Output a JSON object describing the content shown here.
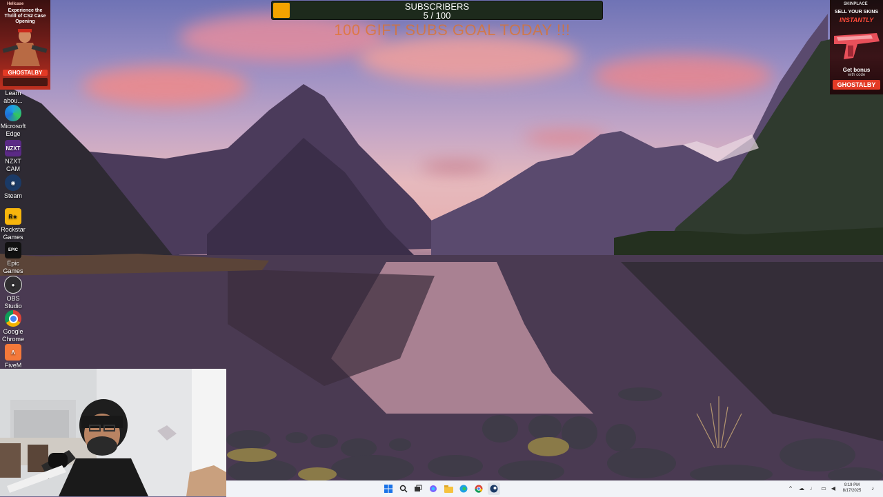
{
  "overlay": {
    "sub_title": "SUBSCRIBERS",
    "sub_count": "5 / 100",
    "sub_progress": 0.05,
    "goal_text": "100 GIFT SUBS GOAL TODAY !!!"
  },
  "ad_left": {
    "brand": "Hellcase",
    "headline": "Experience the Thrill of CS2 Case Opening",
    "code": "GHOSTALBY"
  },
  "ad_right": {
    "brand": "SKINPLACE",
    "headline1": "SELL YOUR SKINS",
    "headline2": "INSTANTLY",
    "bonus": "Get bonus",
    "bonus_sub": "with code",
    "code": "GHOSTALBY"
  },
  "desktop_icons": [
    {
      "label": "Learn abou...",
      "icon": "learn-icon"
    },
    {
      "label": "Microsoft Edge",
      "icon": "edge-icon"
    },
    {
      "label": "NZXT CAM",
      "icon": "nzxt-icon"
    },
    {
      "label": "Steam",
      "icon": "steam-icon"
    },
    {
      "label": "Rockstar Games ...",
      "icon": "rockstar-icon"
    },
    {
      "label": "Epic Games ...",
      "icon": "epic-icon"
    },
    {
      "label": "OBS Studio",
      "icon": "obs-icon"
    },
    {
      "label": "Google Chrome",
      "icon": "chrome-icon"
    },
    {
      "label": "FiveM",
      "icon": "fivem-icon"
    }
  ],
  "taskbar": {
    "apps": [
      "start-icon",
      "search-icon",
      "task-view-icon",
      "copilot-icon",
      "file-explorer-icon",
      "edge-icon",
      "chrome-icon",
      "steam-icon"
    ],
    "time": "9:19 PM",
    "date": "8/17/2025"
  },
  "colors": {
    "progress_fill": "#f4a300",
    "goal_text": "#e4711f",
    "taskbar_bg": "#f1f3f7"
  }
}
